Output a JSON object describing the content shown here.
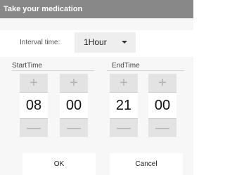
{
  "dialog": {
    "title": "Take your medication"
  },
  "interval": {
    "label": "Interval time:",
    "selected": "1Hour"
  },
  "start": {
    "label": "StartTime",
    "hour": "08",
    "minute": "00"
  },
  "end": {
    "label": "EndTime",
    "hour": "21",
    "minute": "00"
  },
  "pickers": {
    "plus_glyph": "+",
    "minus_glyph": "—"
  },
  "actions": {
    "ok_label": "OK",
    "cancel_label": "Cancel"
  }
}
